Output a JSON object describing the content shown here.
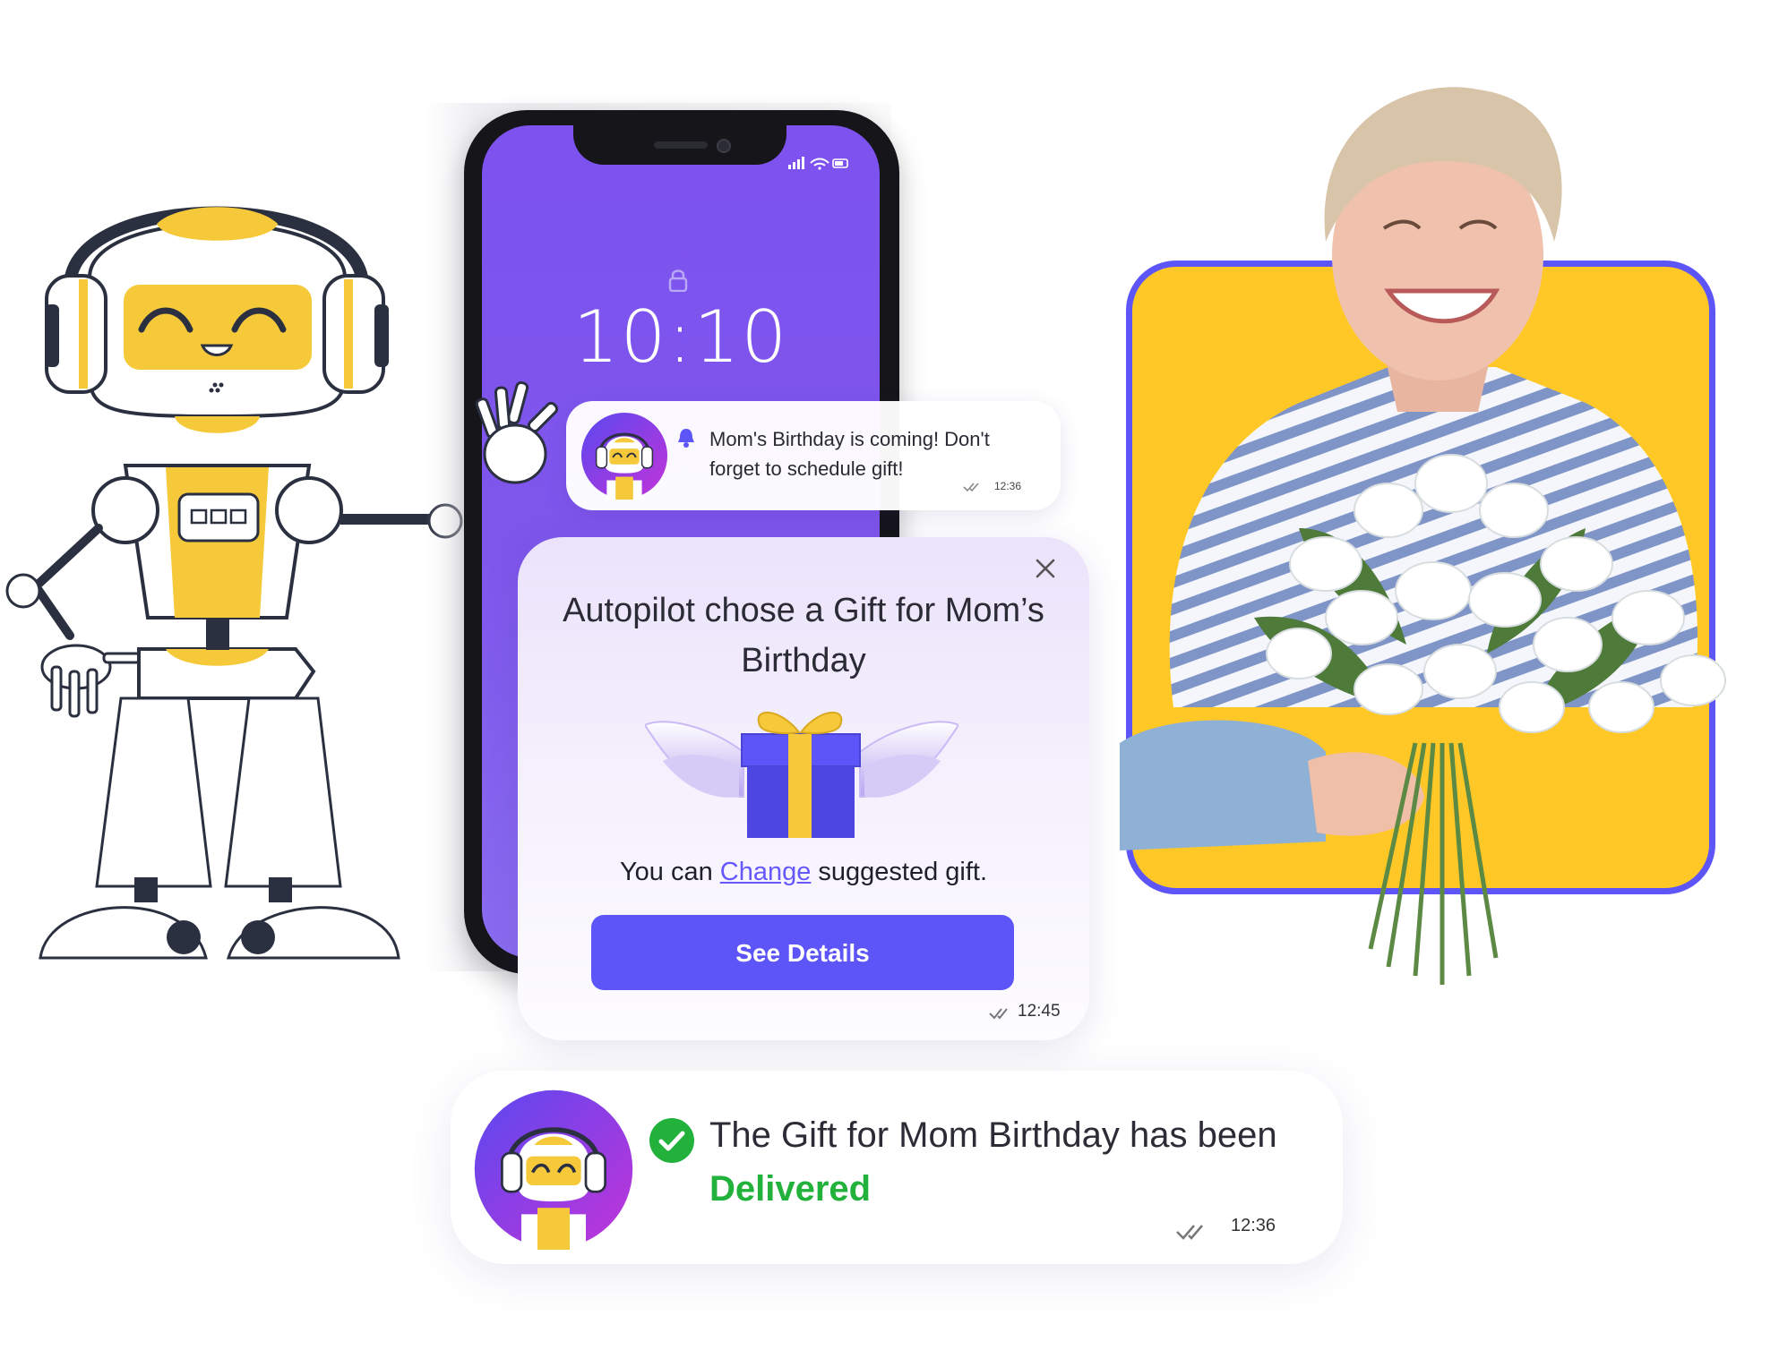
{
  "phone": {
    "clock": "10:10",
    "status_icons": "signal-wifi-battery"
  },
  "notification": {
    "text": "Mom's Birthday is coming! Don't forget to schedule gift!",
    "time": "12:36",
    "icon": "bell-icon"
  },
  "gift_card": {
    "title": "Autopilot chose a Gift for Mom’s Birthday",
    "sub_prefix": "You can ",
    "change_link": "Change",
    "sub_suffix": " suggested gift.",
    "button_label": "See Details",
    "time": "12:45"
  },
  "delivered_card": {
    "text_prefix": "The Gift for Mom Birthday has been ",
    "status_word": "Delivered",
    "time": "12:36"
  },
  "colors": {
    "accent_purple": "#5d55f8",
    "phone_screen": "#7d52ef",
    "robot_yellow": "#f5c93a",
    "frame_yellow": "#ffc826",
    "delivered_green": "#22b13b"
  }
}
